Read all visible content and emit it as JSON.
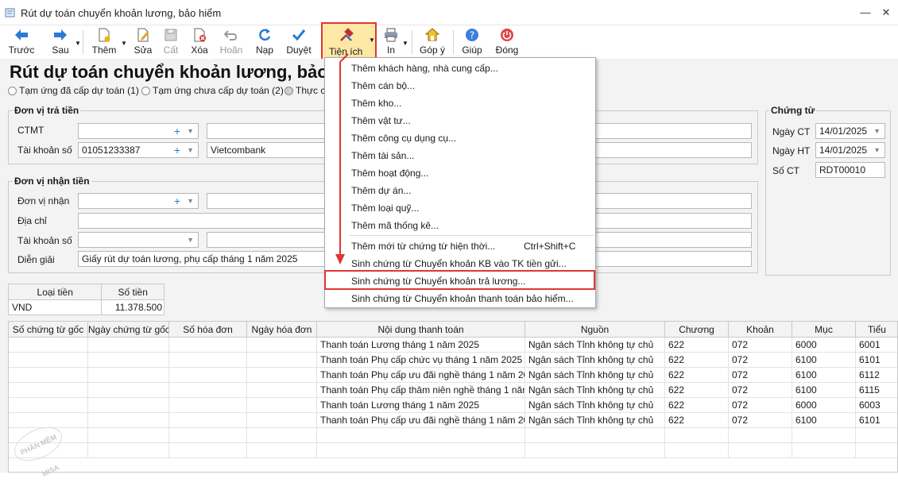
{
  "window": {
    "title": "Rút dự toán chuyển khoản lương, bảo hiểm",
    "minimize": "—",
    "close": "✕"
  },
  "toolbar": {
    "prev": "Trước",
    "next": "Sau",
    "add": "Thêm",
    "edit": "Sửa",
    "save": "Cất",
    "delete": "Xóa",
    "undo": "Hoãn",
    "reload": "Nạp",
    "approve": "Duyệt",
    "utilities": "Tiện ích",
    "print": "In",
    "feedback": "Góp ý",
    "help": "Giúp",
    "close": "Đóng"
  },
  "page": {
    "title": "Rút dự toán chuyển khoản lương, bảo",
    "radios": [
      "Tạm ứng đã cấp dự toán (1)",
      "Tạm ứng chưa cấp dự toán (2)",
      "Thực c"
    ]
  },
  "payer": {
    "title": "Đơn vị trả tiền",
    "ctmt_label": "CTMT",
    "account_label": "Tài khoản số",
    "account_value": "01051233387",
    "bank_value": "Vietcombank"
  },
  "payee": {
    "title": "Đơn vị nhận tiền",
    "unit_label": "Đơn vị nhận",
    "address_label": "Địa chỉ",
    "account_label": "Tài khoản số",
    "description_label": "Diễn giải",
    "description_value": "Giấy rút dự toán lương, phụ cấp tháng 1 năm 2025"
  },
  "voucher": {
    "title": "Chứng từ",
    "date_label": "Ngày CT",
    "date_value": "14/01/2025",
    "accounting_date_label": "Ngày HT",
    "accounting_date_value": "14/01/2025",
    "number_label": "Số CT",
    "number_value": "RDT00010"
  },
  "money": {
    "headers": [
      "Loại tiền",
      "Số tiền"
    ],
    "currency": "VND",
    "amount": "11.378.500"
  },
  "grid": {
    "headers": [
      "Số chứng từ gốc",
      "Ngày chứng từ gốc",
      "Số hóa đơn",
      "Ngày hóa đơn",
      "Nội dung thanh toán",
      "Nguồn",
      "Chương",
      "Khoản",
      "Mục",
      "Tiểu"
    ],
    "rows": [
      [
        "Thanh toán Lương tháng 1 năm 2025",
        "Ngân sách Tỉnh không tự chủ",
        "622",
        "072",
        "6000",
        "6001"
      ],
      [
        "Thanh toán Phụ cấp chức vụ tháng 1 năm 2025",
        "Ngân sách Tỉnh không tự chủ",
        "622",
        "072",
        "6100",
        "6101"
      ],
      [
        "Thanh toán Phụ cấp ưu đãi nghề tháng 1 năm 20...",
        "Ngân sách Tỉnh không tự chủ",
        "622",
        "072",
        "6100",
        "6112"
      ],
      [
        "Thanh toán Phụ cấp thâm niên nghề tháng 1 năm...",
        "Ngân sách Tỉnh không tự chủ",
        "622",
        "072",
        "6100",
        "6115"
      ],
      [
        "Thanh toán Lương tháng 1 năm 2025",
        "Ngân sách Tỉnh không tự chủ",
        "622",
        "072",
        "6000",
        "6003"
      ],
      [
        "Thanh toán Phụ cấp ưu đãi nghề tháng 1 năm 20...",
        "Ngân sách Tỉnh không tự chủ",
        "622",
        "072",
        "6100",
        "6101"
      ]
    ]
  },
  "watermark": "PHẦN MỀM MISA",
  "menu": {
    "items": [
      "Thêm khách hàng, nhà cung cấp...",
      "Thêm cán bộ...",
      "Thêm kho...",
      "Thêm vật tư...",
      "Thêm công cụ dụng cụ...",
      "Thêm tài sản...",
      "Thêm hoạt động...",
      "Thêm dự án...",
      "Thêm loại quỹ...",
      "Thêm mã thống kê...",
      "Thêm mới từ chứng từ hiện thời...",
      "Sinh chứng từ Chuyển khoản KB vào TK tiền gửi...",
      "Sinh chứng từ Chuyển khoản trả lương...",
      "Sinh chứng từ Chuyển khoản thanh toán bảo hiểm..."
    ],
    "shortcut": "Ctrl+Shift+C"
  },
  "colors": {
    "highlight_border": "#e03535",
    "utilities_bg": "#fde8a6",
    "accent_blue": "#2a7bd4"
  }
}
